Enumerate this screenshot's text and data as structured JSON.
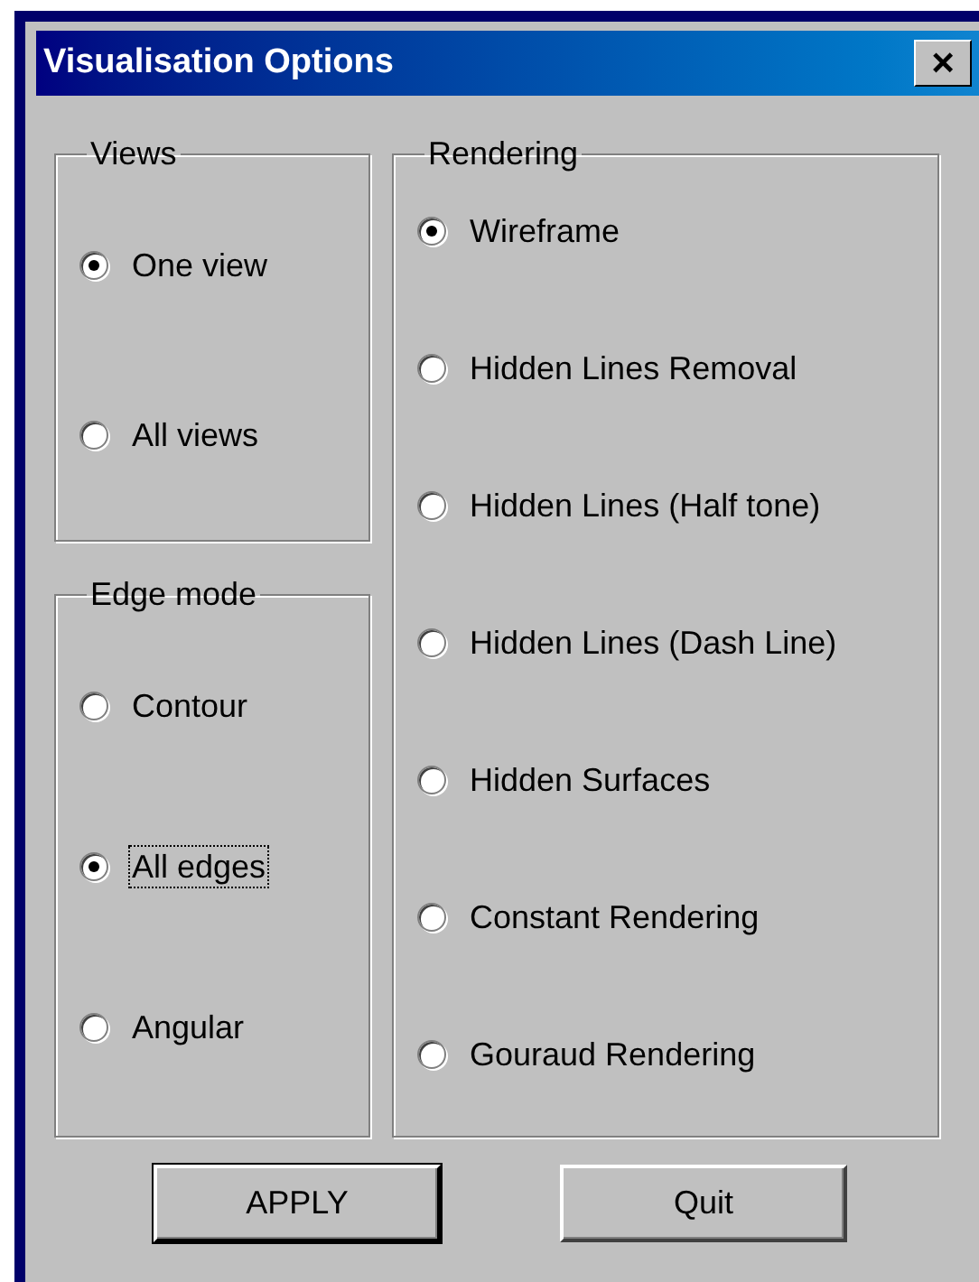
{
  "window": {
    "title": "Visualisation Options",
    "close_label": "×"
  },
  "views": {
    "title": "Views",
    "options": [
      {
        "label": "One view",
        "selected": true,
        "focused": false
      },
      {
        "label": "All views",
        "selected": false,
        "focused": false
      }
    ]
  },
  "edge_mode": {
    "title": "Edge mode",
    "options": [
      {
        "label": "Contour",
        "selected": false,
        "focused": false
      },
      {
        "label": "All edges",
        "selected": true,
        "focused": true
      },
      {
        "label": "Angular",
        "selected": false,
        "focused": false
      }
    ]
  },
  "rendering": {
    "title": "Rendering",
    "options": [
      {
        "label": "Wireframe",
        "selected": true,
        "focused": false
      },
      {
        "label": "Hidden Lines Removal",
        "selected": false,
        "focused": false
      },
      {
        "label": "Hidden Lines (Half tone)",
        "selected": false,
        "focused": false
      },
      {
        "label": "Hidden Lines (Dash Line)",
        "selected": false,
        "focused": false
      },
      {
        "label": "Hidden Surfaces",
        "selected": false,
        "focused": false
      },
      {
        "label": "Constant Rendering",
        "selected": false,
        "focused": false
      },
      {
        "label": "Gouraud Rendering",
        "selected": false,
        "focused": false
      }
    ]
  },
  "buttons": [
    {
      "label": "APPLY",
      "default": true
    },
    {
      "label": "Quit",
      "default": false
    }
  ]
}
